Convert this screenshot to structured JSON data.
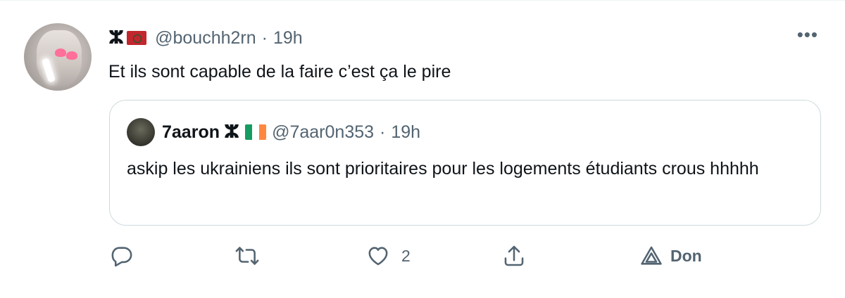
{
  "tweet": {
    "author": {
      "symbol": "ⵣ",
      "handle": "@bouchh2rn",
      "separator": "·",
      "time": "19h"
    },
    "more_label": "•••",
    "text": "Et ils sont capable de la faire c’est ça le pire",
    "quoted": {
      "name": "7aaron",
      "symbol": "ⵣ",
      "handle": "@7aar0n353",
      "separator": "·",
      "time": "19h",
      "text": "askip les ukrainiens ils sont prioritaires pour les logements étudiants crous hhhhh"
    },
    "actions": {
      "reply_icon": "reply-icon",
      "retweet_icon": "retweet-icon",
      "like_icon": "heart-icon",
      "like_count": "2",
      "share_icon": "share-icon",
      "don_icon": "don-triangle-icon",
      "don_label": "Don"
    }
  },
  "colors": {
    "text_primary": "#0f1419",
    "text_secondary": "#536471",
    "border": "#cfd9de",
    "flag_morocco_red": "#c1272d",
    "flag_ireland": [
      "#169b62",
      "#ffffff",
      "#ff883e"
    ]
  }
}
